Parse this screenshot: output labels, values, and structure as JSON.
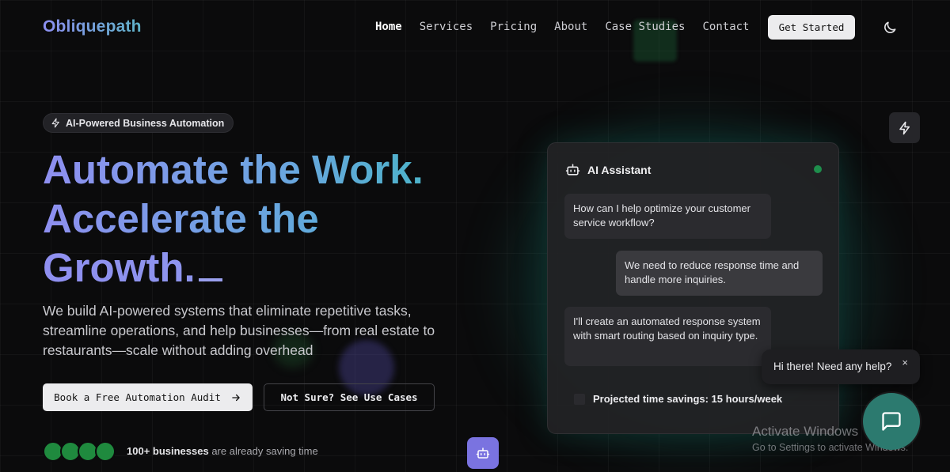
{
  "brand": {
    "logo": "Obliquepath"
  },
  "nav": {
    "items": [
      "Home",
      "Services",
      "Pricing",
      "About",
      "Case Studies",
      "Contact"
    ],
    "active": "Home",
    "cta": "Get Started"
  },
  "hero": {
    "badge": "AI-Powered Business Automation",
    "headline_lines": [
      "Automate the Work.",
      "Accelerate the",
      "Growth."
    ],
    "cursor": "_",
    "subtext": "We build AI-powered systems that eliminate repetitive tasks, streamline operations, and help businesses—from real estate to restaurants—scale without adding overhead",
    "primary_cta": "Book a Free Automation Audit",
    "secondary_cta": "Not Sure? See Use Cases",
    "social_proof_bold": "100+ businesses",
    "social_proof_rest": " are already saving time"
  },
  "ai_card": {
    "title": "AI Assistant",
    "messages": [
      {
        "role": "ai",
        "text": "How can I help optimize your customer service workflow?"
      },
      {
        "role": "user",
        "text": "We need to reduce response time and handle more inquiries."
      },
      {
        "role": "ai",
        "text": "I'll create an automated response system with smart routing based on inquiry type."
      }
    ],
    "savings": "Projected time savings: 15 hours/week"
  },
  "chat_widget": {
    "tooltip": "Hi there! Need any help?",
    "close": "×"
  },
  "os_watermark": {
    "line1": "Activate Windows",
    "line2": "Go to Settings to activate Windows."
  },
  "colors": {
    "accent_purple": "#8d8ff2",
    "accent_teal": "#4fb3c9",
    "status_green": "#1e8e4c",
    "chat_fab": "#2c7a6f",
    "robot_fab": "#7a73e0"
  },
  "icons": [
    "bolt-icon",
    "moon-icon",
    "robot-icon",
    "arrow-right-icon",
    "message-square-icon",
    "clock-icon"
  ]
}
